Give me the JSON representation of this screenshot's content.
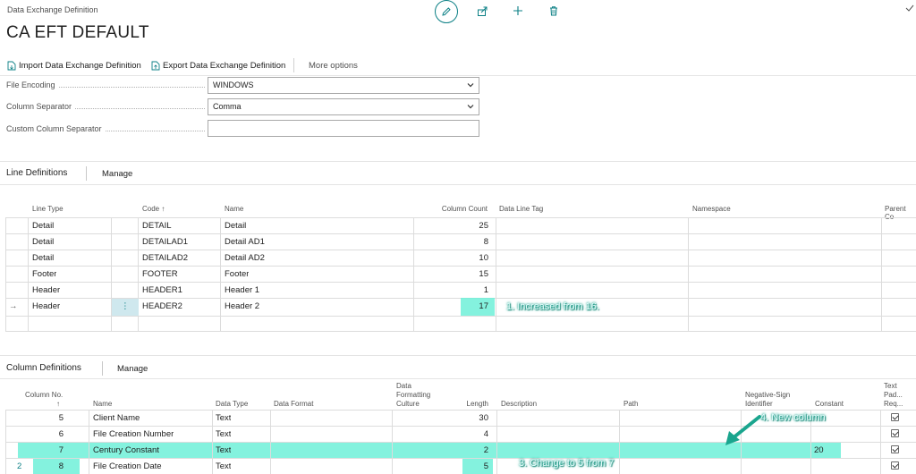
{
  "header": {
    "caption": "Data Exchange Definition",
    "title": "CA EFT DEFAULT",
    "icons": [
      "pencil-icon",
      "share-icon",
      "plus-icon",
      "trash-icon",
      "check-icon"
    ]
  },
  "actions": {
    "import_label": "Import Data Exchange Definition",
    "export_label": "Export Data Exchange Definition",
    "more_label": "More options"
  },
  "fields": {
    "file_encoding_label": "File Encoding",
    "file_encoding_value": "WINDOWS",
    "column_separator_label": "Column Separator",
    "column_separator_value": "Comma",
    "custom_separator_label": "Custom Column Separator",
    "custom_separator_value": ""
  },
  "line_definitions": {
    "title": "Line Definitions",
    "manage": "Manage",
    "headers": {
      "line_type": "Line Type",
      "code": "Code ↑",
      "name": "Name",
      "column_count": "Column Count",
      "data_line_tag": "Data Line Tag",
      "namespace": "Namespace",
      "parent_code": "Parent Co"
    },
    "rows": [
      {
        "line_type": "Detail",
        "code": "DETAIL",
        "name": "Detail",
        "column_count": "25"
      },
      {
        "line_type": "Detail",
        "code": "DETAILAD1",
        "name": "Detail AD1",
        "column_count": "8"
      },
      {
        "line_type": "Detail",
        "code": "DETAILAD2",
        "name": "Detail AD2",
        "column_count": "10"
      },
      {
        "line_type": "Footer",
        "code": "FOOTER",
        "name": "Footer",
        "column_count": "15"
      },
      {
        "line_type": "Header",
        "code": "HEADER1",
        "name": "Header 1",
        "column_count": "1"
      },
      {
        "line_type": "Header",
        "code": "HEADER2",
        "name": "Header 2",
        "column_count": "17"
      }
    ],
    "selected_marker": "→",
    "row_menu": "⋮"
  },
  "column_definitions": {
    "title": "Column Definitions",
    "manage": "Manage",
    "headers": {
      "column_no": "Column No.",
      "column_no_arrow": "↑",
      "name": "Name",
      "data_type": "Data Type",
      "data_format": "Data Format",
      "data_formatting_culture_1": "Data",
      "data_formatting_culture_2": "Formatting",
      "data_formatting_culture_3": "Culture",
      "length": "Length",
      "description": "Description",
      "path": "Path",
      "neg_sign_1": "Negative-Sign",
      "neg_sign_2": "Identifier",
      "constant": "Constant",
      "text_pad_1": "Text",
      "text_pad_2": "Pad...",
      "text_pad_3": "Req..."
    },
    "rows": [
      {
        "no": "5",
        "name": "Client Name",
        "type": "Text",
        "length": "30",
        "constant": ""
      },
      {
        "no": "6",
        "name": "File Creation Number",
        "type": "Text",
        "length": "4",
        "constant": ""
      },
      {
        "no": "7",
        "name": "Century Constant",
        "type": "Text",
        "length": "2",
        "constant": "20"
      },
      {
        "no": "8",
        "name": "File Creation Date",
        "type": "Text",
        "length": "5",
        "constant": ""
      }
    ],
    "side_number": "2"
  },
  "annotations": {
    "a1": "1. Increased from 16.",
    "a3": "3. Change to 5 from 7",
    "a4": "4. New column"
  },
  "colors": {
    "accent": "#0a7f84",
    "highlight": "#6ef0d8",
    "annotation_arrow": "#1aa58e"
  }
}
